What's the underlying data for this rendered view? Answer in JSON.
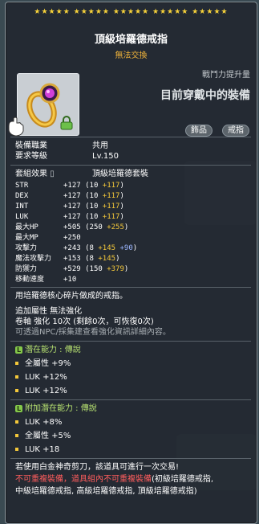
{
  "stars": "★★★★★ ★★★★★ ★★★★★ ★★★★★ ★★★★★",
  "item": {
    "name": "頂級培羅德戒指",
    "trade": "無法交換",
    "power_label": "戰鬥力提升量",
    "power_text": "目前穿戴中的裝備",
    "tags": [
      "飾品",
      "戒指"
    ]
  },
  "info": {
    "job_label": "裝備職業",
    "job_value": "共用",
    "level_label": "要求等級",
    "level_value": "Lv.150"
  },
  "set": {
    "label": "套組效果",
    "value": "頂級培羅德套裝"
  },
  "stats": [
    {
      "name": "STR",
      "total": "+127",
      "base": "(10 ",
      "bonus": "+117",
      "end": ")"
    },
    {
      "name": "DEX",
      "total": "+127",
      "base": "(10 ",
      "bonus": "+117",
      "end": ")"
    },
    {
      "name": "INT",
      "total": "+127",
      "base": "(10 ",
      "bonus": "+117",
      "end": ")"
    },
    {
      "name": "LUK",
      "total": "+127",
      "base": "(10 ",
      "bonus": "+117",
      "end": ")"
    },
    {
      "name": "最大HP",
      "total": "+505",
      "base": "(250 ",
      "bonus": "+255",
      "end": ")"
    },
    {
      "name": "最大MP",
      "total": "+250",
      "base": "",
      "bonus": "",
      "end": ""
    },
    {
      "name": "攻擊力",
      "total": "+243",
      "base": "(8 ",
      "bonus": "+145",
      "extra": " +90",
      "end": ")"
    },
    {
      "name": "魔法攻擊力",
      "total": "+153",
      "base": "(8 ",
      "bonus": "+145",
      "end": ")"
    },
    {
      "name": "防禦力",
      "total": "+529",
      "base": "(150 ",
      "bonus": "+379",
      "end": ")"
    },
    {
      "name": "移動速度",
      "total": "+10",
      "base": "",
      "bonus": "",
      "end": ""
    }
  ],
  "desc": "用培羅德核心碎片做成的戒指。",
  "extra": {
    "line1": "追加屬性  無法強化",
    "line2": "卷軸 強化 10次 (剩餘0次，可恢復0次)",
    "line3": "可透過NPC/採集建查看強化資訊詳細內容。"
  },
  "potential": {
    "icon": "L",
    "title": "潛在能力 : 傳說",
    "lines": [
      "全屬性  +9%",
      "LUK +12%",
      "LUK +12%"
    ]
  },
  "bonus_potential": {
    "icon": "L",
    "title": "附加潛在能力 : 傳說",
    "lines": [
      "LUK +8%",
      "全屬性  +5%",
      "LUK +18"
    ]
  },
  "footer": {
    "line1": "若使用白金神奇剪刀，該道具可進行一次交易!",
    "line2_red": "不可重複裝備，道具組內不可重複裝備",
    "line2_white": "(初級培羅德戒指,",
    "line3": "中級培羅德戒指, 高級培羅德戒指, 頂級培羅德戒指)"
  },
  "colors": {
    "gold": "#f4c83a",
    "potential_green": "#84c84a",
    "warning_red": "#ff5d5d"
  }
}
